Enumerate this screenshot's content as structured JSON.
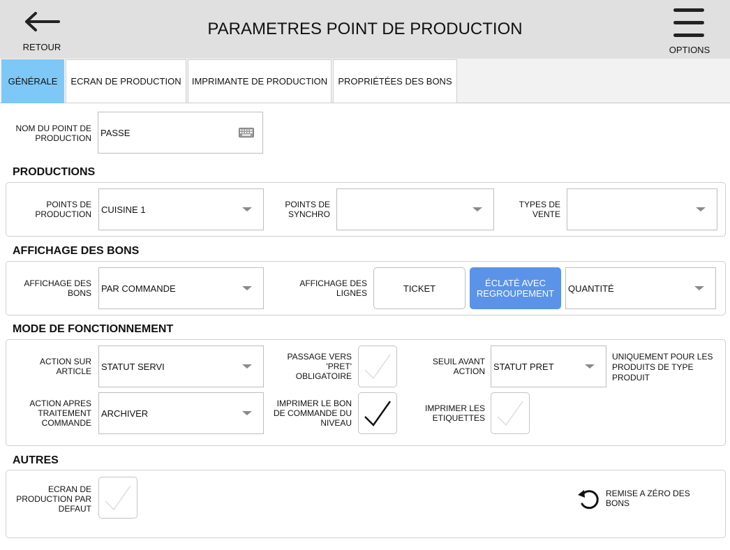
{
  "header": {
    "title": "PARAMETRES POINT DE PRODUCTION",
    "back_label": "RETOUR",
    "options_label": "OPTIONS"
  },
  "tabs": [
    {
      "label": "GÉNÉRALE",
      "active": true
    },
    {
      "label": "ECRAN DE PRODUCTION",
      "active": false
    },
    {
      "label": "IMPRIMANTE DE PRODUCTION",
      "active": false
    },
    {
      "label": "PROPRIÉTÉES DES BONS",
      "active": false
    }
  ],
  "name_field": {
    "label": "NOM DU POINT DE PRODUCTION",
    "value": "PASSE",
    "icon": "keyboard-icon"
  },
  "productions": {
    "title": "PRODUCTIONS",
    "points_label": "POINTS DE PRODUCTION",
    "points_value": "CUISINE 1",
    "synchro_label": "POINTS DE SYNCHRO",
    "synchro_value": "",
    "types_label": "TYPES DE VENTE",
    "types_value": ""
  },
  "affichage": {
    "title": "AFFICHAGE DES BONS",
    "bons_label": "AFFICHAGE DES BONS",
    "bons_value": "PAR COMMANDE",
    "lignes_label": "AFFICHAGE DES LIGNES",
    "ticket_label": "TICKET",
    "eclate_label": "ÉCLATÉ AVEC REGROUPEMENT",
    "selected": "ÉCLATÉ AVEC REGROUPEMENT",
    "quantite_value": "QUANTITÉ"
  },
  "mode": {
    "title": "MODE DE FONCTIONNEMENT",
    "action_article_label": "ACTION SUR ARTICLE",
    "action_article_value": "STATUT SERVI",
    "passage_label": "PASSAGE VERS 'PRET' OBLIGATOIRE",
    "passage_checked": false,
    "seuil_label": "SEUIL AVANT ACTION",
    "seuil_value": "STATUT PRET",
    "seuil_note": "UNIQUEMENT POUR LES PRODUITS DE TYPE PRODUIT",
    "action_apres_label": "ACTION APRES TRAITEMENT COMMANDE",
    "action_apres_value": "ARCHIVER",
    "imprimer_bon_label": "IMPRIMER LE BON DE COMMANDE DU NIVEAU",
    "imprimer_bon_checked": true,
    "imprimer_etiq_label": "IMPRIMER LES ETIQUETTES",
    "imprimer_etiq_checked": false
  },
  "autres": {
    "title": "AUTRES",
    "ecran_defaut_label": "ECRAN DE PRODUCTION PAR DEFAUT",
    "ecran_defaut_checked": false,
    "reset_label": "REMISE A ZÉRO DES BONS"
  },
  "colors": {
    "active_tab": "#7ec8f8",
    "selected_toggle": "#5a93e8",
    "header_bg": "#e0e0e0"
  }
}
